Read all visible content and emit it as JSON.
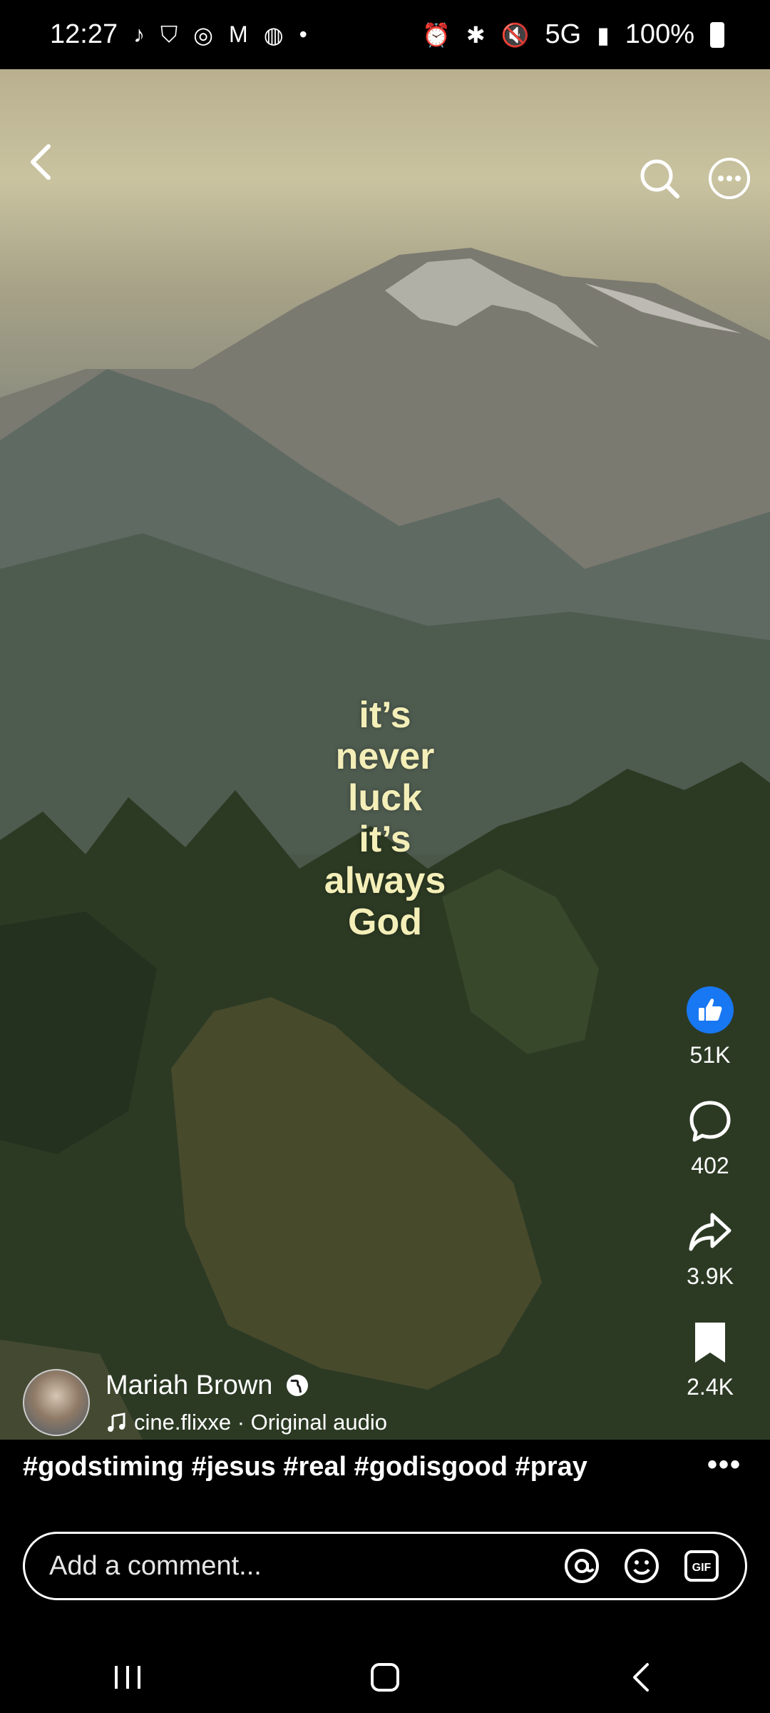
{
  "status_bar": {
    "time": "12:27",
    "network": "5G",
    "battery": "100%",
    "left_icons": [
      "tiktok-icon",
      "shield-icon",
      "chrome-icon",
      "gmail-icon",
      "app-icon",
      "dot-icon"
    ],
    "right_icons": [
      "alarm-icon",
      "bluetooth-icon",
      "mute-icon",
      "signal-icon",
      "battery-icon"
    ]
  },
  "video": {
    "overlay_lines": [
      "it’s",
      "never",
      "luck",
      "it’s",
      "always",
      "God"
    ]
  },
  "actions": {
    "likes": "51K",
    "comments": "402",
    "shares": "3.9K",
    "saves": "2.4K"
  },
  "author": {
    "name": "Mariah Brown",
    "audio": "cine.flixxe · Original audio"
  },
  "caption": "#godstiming #jesus #real #godisgood #pray",
  "more": "•••",
  "comment": {
    "placeholder": "Add a comment..."
  },
  "colors": {
    "like_blue": "#1877f2",
    "overlay_text": "#f4efb8"
  }
}
